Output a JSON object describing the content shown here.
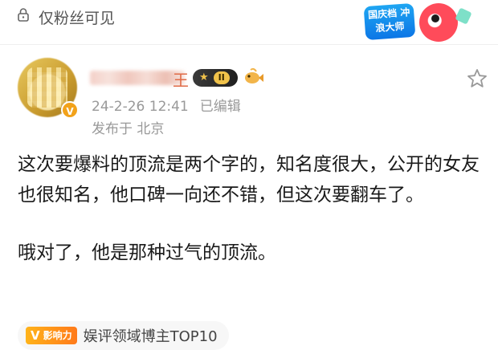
{
  "header": {
    "privacy": "仅粉丝可见",
    "promo": "国庆档 冲浪大师"
  },
  "user": {
    "name_tail": "王",
    "level": "II",
    "verified_icon": "V"
  },
  "post": {
    "time": "24-2-26 12:41",
    "edited": "已编辑",
    "location": "发布于 北京",
    "paragraph1": "这次要爆料的顶流是两个字的，知名度很大，公开的女友也很知名，他口碑一向还不错，但这次要翻车了。",
    "paragraph2": "哦对了，他是那种过气的顶流。"
  },
  "tag": {
    "badge": "影响力",
    "badge_letter": "V",
    "text": "娱评领域博主TOP10"
  },
  "colors": {
    "accent": "#e06b47",
    "meta": "#999999",
    "badge_gold": "#f0c24a"
  }
}
